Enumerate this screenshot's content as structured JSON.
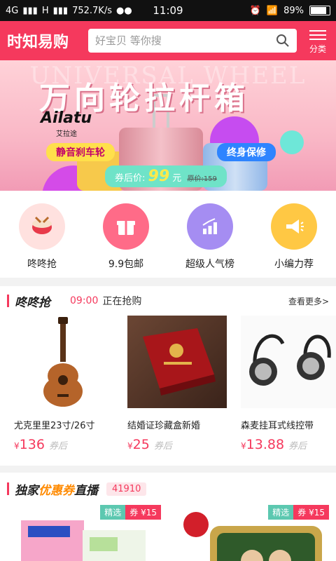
{
  "status": {
    "network1": "4G",
    "network2": "H",
    "speed": "752.7K/s",
    "time": "11:09",
    "battery": "89%"
  },
  "header": {
    "logo": "时知易购",
    "search_placeholder": "好宝贝 等你搜",
    "category_label": "分类"
  },
  "banner": {
    "bg_text": "UNIVERSAL WHEEL",
    "title": "万向轮拉杆箱",
    "brand": "Ailatu",
    "brand_sub": "艾拉途",
    "feature1": "静音刹车轮",
    "feature2": "终身保修",
    "price_prefix": "券后价:",
    "price": "99",
    "price_unit": "元",
    "original_price": "原价:159"
  },
  "quick": [
    {
      "label": "咚咚抢",
      "icon": "drum-icon",
      "color": "#ffe1df"
    },
    {
      "label": "9.9包邮",
      "icon": "gift-icon",
      "color": "#ff6b88"
    },
    {
      "label": "超级人气榜",
      "icon": "chart-icon",
      "color": "#a58df2"
    },
    {
      "label": "小编力荐",
      "icon": "megaphone-icon",
      "color": "#ffc844"
    }
  ],
  "flash": {
    "title": "咚咚抢",
    "time": "09:00",
    "status": "正在抢购",
    "more": "查看更多>",
    "products": [
      {
        "name": "尤克里里23寸/26寸",
        "currency": "¥",
        "price": "136",
        "after": "券后"
      },
      {
        "name": "结婚证珍藏盒新婚",
        "currency": "¥",
        "price": "25",
        "after": "券后"
      },
      {
        "name": "森麦挂耳式线控带",
        "currency": "¥",
        "price": "13.88",
        "after": "券后"
      }
    ]
  },
  "coupon": {
    "title_pre": "独家",
    "title_hl": "优惠券",
    "title_post": "直播",
    "count": "41910",
    "cards": [
      {
        "tag1": "精选",
        "tag2": "券 ¥15"
      },
      {
        "tag1": "精选",
        "tag2": "券 ¥15"
      }
    ]
  }
}
